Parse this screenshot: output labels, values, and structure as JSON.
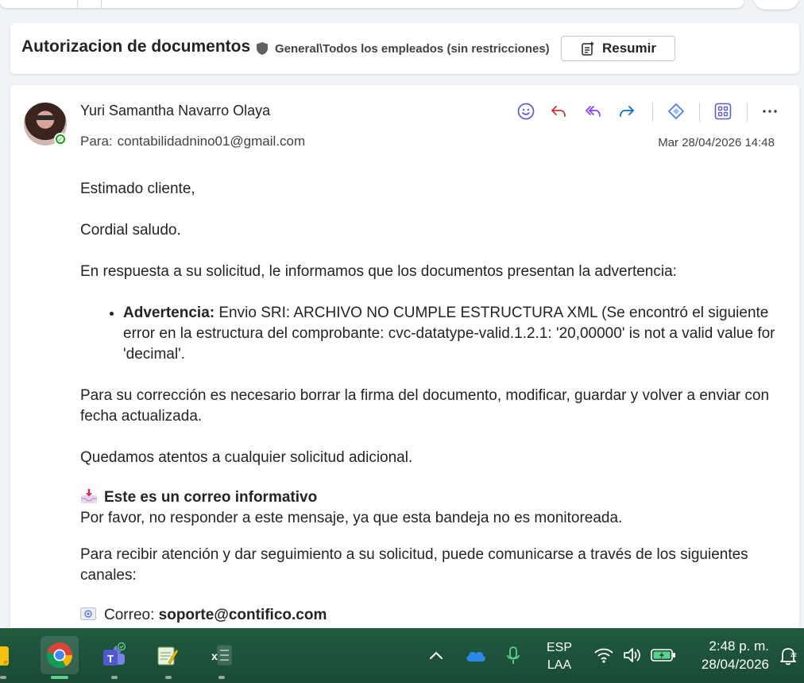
{
  "subject": {
    "title": "Autorizacion de documentos",
    "label": "General\\Todos los empleados (sin restricciones)",
    "summarize_button": "Resumir"
  },
  "message": {
    "sender": "Yuri Samantha Navarro Olaya",
    "to_label": "Para:",
    "to_address": "contabilidadnino01@gmail.com",
    "date": "Mar 28/04/2026 14:48",
    "actions": [
      "smiley-icon",
      "reply-icon",
      "reply-all-icon",
      "forward-icon",
      "copilot-icon",
      "apps-icon",
      "more-icon"
    ],
    "body": {
      "greeting": "Estimado cliente,",
      "salute": "Cordial saludo.",
      "intro": "En respuesta a su solicitud, le informamos que los documentos presentan la advertencia:",
      "warning_label": "Advertencia:",
      "warning_text": " Envio SRI: ARCHIVO NO CUMPLE ESTRUCTURA XML (Se encontró el siguiente error en la estructura del comprobante: cvc-datatype-valid.1.2.1: '20,00000' is not a valid value for 'decimal'.",
      "correction": "Para su corrección es necesario borrar la firma del documento, modificar, guardar y volver a enviar con fecha actualizada.",
      "closing": "Quedamos atentos a cualquier solicitud adicional.",
      "info_heading": "Este es un correo informativo",
      "info_text": "Por favor, no responder a este mensaje, ya que esta bandeja no es monitoreada.",
      "channels_intro": "Para recibir atención y dar seguimiento a su solicitud, puede comunicarse a través de los siguientes canales:",
      "email_label": "Correo: ",
      "email_value": "soporte@contifico.com"
    }
  },
  "taskbar": {
    "apps": [
      "sticky-notes",
      "chrome",
      "teams",
      "notepad",
      "excel"
    ],
    "lang_top": "ESP",
    "lang_bottom": "LAA",
    "time": "2:48 p. m.",
    "date": "28/04/2026"
  },
  "colors": {
    "accent": "#5b5fc7",
    "reply": "#c0392b",
    "reply_all": "#8a3ffc",
    "forward": "#0f6cbd",
    "taskbar": "#1e4f3a",
    "presence": "#13a10e"
  }
}
